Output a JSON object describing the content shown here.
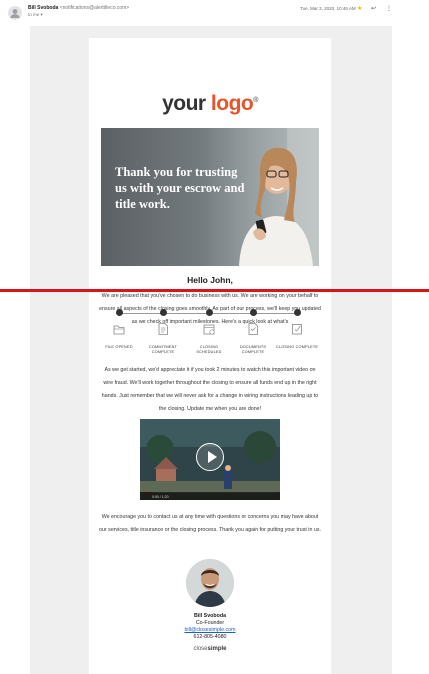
{
  "header": {
    "sender_name": "Bill Svoboda",
    "sender_email": "<notifications@alertitleco.com>",
    "to": "to me",
    "date": "Tue, Mar 3, 2020, 10:46 AM"
  },
  "email": {
    "logo_text_main": "your",
    "logo_text_accent": "logo",
    "logo_mark": "®",
    "hero_text": "Thank you for trusting us with your escrow and title work.",
    "greeting": "Hello John,",
    "intro": "We are pleased that you've chosen to do business with us. We are working on your behalf to ensure all aspects of the closing goes smoothly. As part of our process, we'll keep you updated as we check off important milestones. Here's a quick look at what's",
    "milestones": [
      {
        "label": "FILE OPENED"
      },
      {
        "label": "COMMITMENT COMPLETE"
      },
      {
        "label": "CLOSING SCHEDULED"
      },
      {
        "label": "DOCUMENTS COMPLETE"
      },
      {
        "label": "CLOSING COMPLETE"
      }
    ],
    "paragraph2": "As we get started, we'd appreciate it if you took 2 minutes to watch this important video on wire fraud. We'll work together throughout the closing to ensure all funds end up in the right hands. Just remember that we will never ask for a change in wiring instructions leading up to the closing. Update me when you are done!",
    "video_time": "0:00 / 1:20",
    "paragraph3": "We encourage you to contact us at any time with questions or concerns you may have about our services, title insurance or the closing process. Thank you again for putting your trust in us.",
    "signature": {
      "name": "Bill Svoboda",
      "title": "Co-Founder",
      "email": "bill@closesimple.com",
      "phone": "612-805-4080"
    },
    "brand_a": "close",
    "brand_b": "simple"
  },
  "colors": {
    "accent": "#e8542a",
    "divider": "#d9141c",
    "link": "#1a5fc2"
  }
}
